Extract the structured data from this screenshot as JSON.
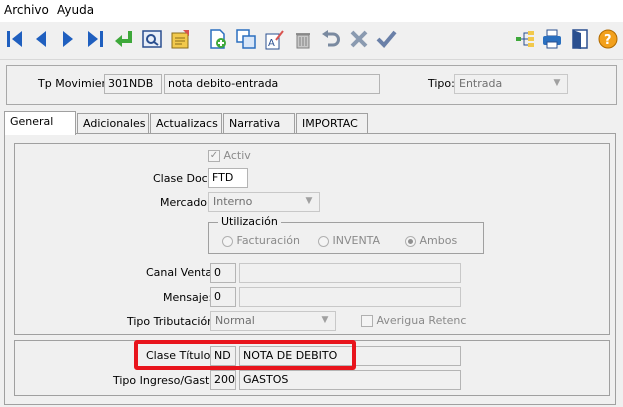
{
  "menu": {
    "archivo": "Archivo",
    "ayuda": "Ayuda"
  },
  "toolbar": {
    "icons": [
      "first-icon",
      "prev-icon",
      "next-icon",
      "last-icon",
      "enter-icon",
      "preview-icon",
      "report-icon",
      "new-icon",
      "copy-icon",
      "edit-icon",
      "delete-icon",
      "undo-icon",
      "cancel-icon",
      "confirm-icon",
      "tree-icon",
      "print-icon",
      "exit-icon",
      "help-icon"
    ]
  },
  "header": {
    "tp_label": "Tp Movimien:",
    "tp_code": "301NDB",
    "tp_desc": "nota debito-entrada",
    "tipo_label": "Tipo:",
    "tipo_value": "Entrada"
  },
  "tabs": [
    "General",
    "Adicionales",
    "Actualizacs",
    "Narrativa",
    "IMPORTAC"
  ],
  "general": {
    "activ_label": "Activ",
    "activ_checked": true,
    "clase_doc_label": "Clase Doc:",
    "clase_doc_value": "FTD",
    "mercado_label": "Mercado:",
    "mercado_value": "Interno",
    "utilizacion_legend": "Utilización",
    "radio_facturacion": "Facturación",
    "radio_inventa": "INVENTA",
    "radio_ambos": "Ambos",
    "radio_selected": "Ambos",
    "canal_venta_label": "Canal Venta:",
    "canal_venta_value": "0",
    "mensaje_label": "Mensaje:",
    "mensaje_value": "0",
    "tipo_tributacion_label": "Tipo Tributación:",
    "tipo_tributacion_value": "Normal",
    "averigua_label": "Averigua Retenc",
    "clase_titulo_label": "Clase Título:",
    "clase_titulo_code": "ND",
    "clase_titulo_desc": "NOTA DE DEBITO",
    "tipo_ingreso_label": "Tipo Ingreso/Gasto:",
    "tipo_ingreso_code": "200",
    "tipo_ingreso_desc": "GASTOS"
  },
  "colors": {
    "highlight": "#e8141c",
    "toolbar_blue": "#1f5fbf",
    "green": "#3ea83a"
  }
}
